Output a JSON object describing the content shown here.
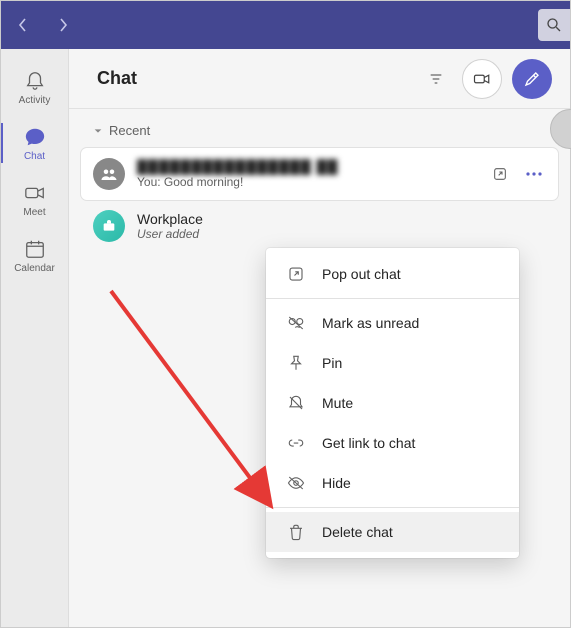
{
  "nav": {
    "items": [
      {
        "id": "activity",
        "label": "Activity"
      },
      {
        "id": "chat",
        "label": "Chat"
      },
      {
        "id": "meet",
        "label": "Meet"
      },
      {
        "id": "calendar",
        "label": "Calendar"
      }
    ],
    "active": "chat"
  },
  "header": {
    "title": "Chat"
  },
  "section": {
    "label": "Recent"
  },
  "chats": [
    {
      "title": "████████████████ ██",
      "preview": "You: Good morning!",
      "redacted": true,
      "selected": true
    },
    {
      "title": "Workplace",
      "preview": "User added",
      "italic": true
    }
  ],
  "menu": {
    "items": [
      {
        "id": "popout",
        "label": "Pop out chat",
        "icon": "popout-icon"
      },
      {
        "divider": true
      },
      {
        "id": "unread",
        "label": "Mark as unread",
        "icon": "unread-icon"
      },
      {
        "id": "pin",
        "label": "Pin",
        "icon": "pin-icon"
      },
      {
        "id": "mute",
        "label": "Mute",
        "icon": "mute-icon"
      },
      {
        "id": "link",
        "label": "Get link to chat",
        "icon": "link-icon"
      },
      {
        "id": "hide",
        "label": "Hide",
        "icon": "hide-icon"
      },
      {
        "divider": true
      },
      {
        "id": "delete",
        "label": "Delete chat",
        "icon": "trash-icon",
        "hovered": true
      }
    ]
  },
  "colors": {
    "brand": "#5b5fc7",
    "titlebar": "#444791",
    "annotation": "#e53935"
  }
}
